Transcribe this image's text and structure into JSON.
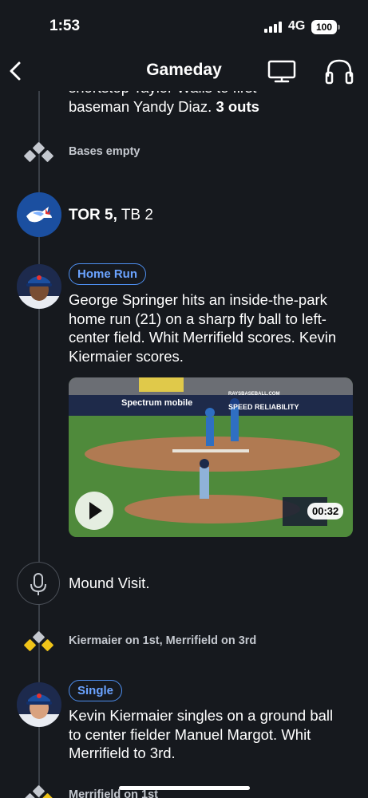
{
  "status": {
    "time": "1:53",
    "network": "4G",
    "battery": "100"
  },
  "nav": {
    "title": "Gameday"
  },
  "colors": {
    "background": "#16191e",
    "accent": "#4e8ff0",
    "runner_on_base": "#f0c419",
    "empty_base": "#c4c8cf"
  },
  "feed": {
    "partial_play": {
      "line1": "shortstop Taylor Walls to first",
      "line2": "baseman Yandy Diaz.",
      "outs": "3 outs"
    },
    "bases_1": "Bases empty",
    "score": {
      "home_team": "TOR 5,",
      "away_team": "TB 2",
      "icon": "blue-jays-logo-icon"
    },
    "home_run": {
      "badge": "Home Run",
      "description": "George Springer hits an inside-the-park home run (21) on a sharp fly ball to left-center field. Whit Merrifield scores. Kevin Kiermaier scores.",
      "video_duration": "00:32",
      "video_signs": [
        "Spectrum mobile",
        "SPEED RELIABILITY",
        "RAYSBASEBALL.COM"
      ]
    },
    "mound_visit": {
      "text": "Mound Visit.",
      "icon": "microphone-icon"
    },
    "bases_2": "Kiermaier on 1st, Merrifield on 3rd",
    "single": {
      "badge": "Single",
      "description": "Kevin Kiermaier singles on a ground ball to center fielder Manuel Margot. Whit Merrifield to 3rd."
    },
    "bases_3": "Merrifield on 1st"
  }
}
